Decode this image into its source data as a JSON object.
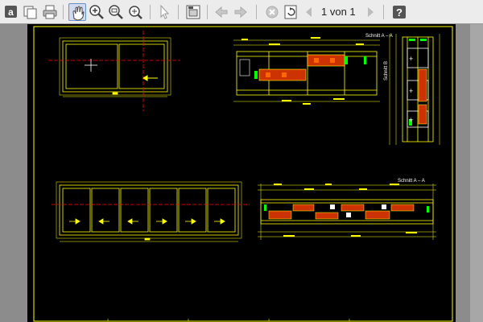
{
  "toolbar": {
    "page_indicator": "1 von 1",
    "buttons": [
      {
        "name": "text-tool-button",
        "label": "a"
      },
      {
        "name": "copy-button"
      },
      {
        "name": "print-button"
      },
      {
        "name": "pan-hand-button"
      },
      {
        "name": "zoom-in-button"
      },
      {
        "name": "zoom-button"
      },
      {
        "name": "zoom-fit-button"
      },
      {
        "name": "select-pointer-button"
      },
      {
        "name": "layout-button"
      },
      {
        "name": "nav-back-button"
      },
      {
        "name": "nav-forward-button"
      },
      {
        "name": "stop-button"
      },
      {
        "name": "refresh-button"
      },
      {
        "name": "prev-page-button"
      },
      {
        "name": "next-page-button"
      },
      {
        "name": "help-button",
        "label": "?"
      }
    ]
  },
  "drawing": {
    "section_label_top": "Schnitt A – A",
    "section_label_side": "Schnitt B",
    "section_label_bottom": "Schnitt A – A",
    "colors": {
      "background": "#000000",
      "frame": "#ffff00",
      "axis": "#ff0000",
      "fill": "#cc3300",
      "seal": "#00ff00",
      "white": "#ffffff"
    }
  }
}
